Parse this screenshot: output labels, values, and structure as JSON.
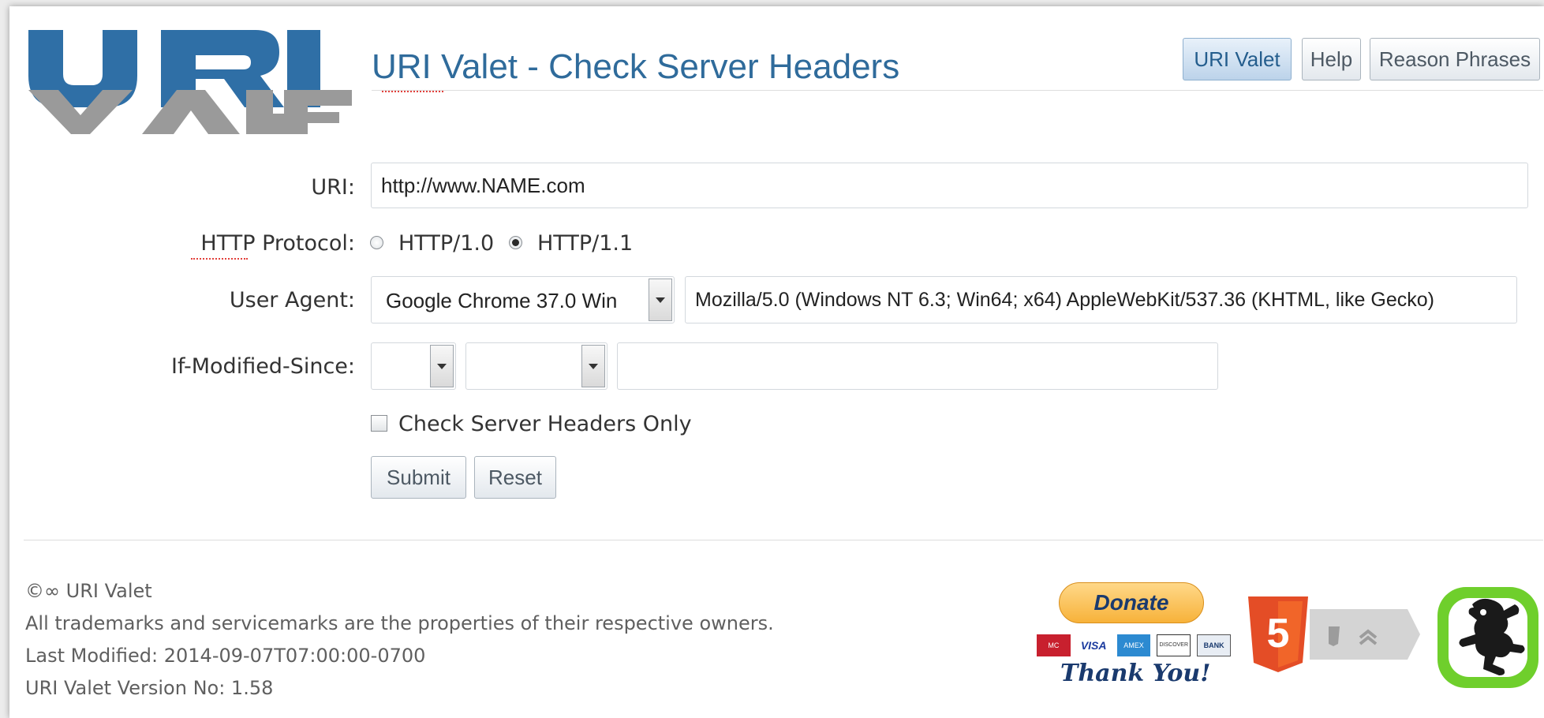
{
  "header": {
    "title": "URI Valet - Check Server Headers",
    "logo_text": "URI VALET",
    "nav": [
      {
        "label": "URI Valet",
        "active": true
      },
      {
        "label": "Help",
        "active": false
      },
      {
        "label": "Reason Phrases",
        "active": false
      }
    ]
  },
  "form": {
    "uri_label": "URI:",
    "uri_value": "http://www.NAME.com",
    "protocol_label": "HTTP Protocol:",
    "protocol_options": [
      "HTTP/1.0",
      "HTTP/1.1"
    ],
    "protocol_selected": "HTTP/1.1",
    "user_agent_label": "User Agent:",
    "user_agent_selected": "Google Chrome 37.0 Win",
    "user_agent_string": "Mozilla/5.0 (Windows NT 6.3; Win64; x64) AppleWebKit/537.36 (KHTML, like Gecko)",
    "if_modified_label": "If-Modified-Since:",
    "if_modified_day": "",
    "if_modified_month": "",
    "if_modified_time": "",
    "headers_only_label": "Check Server Headers Only",
    "headers_only_checked": false,
    "submit_label": "Submit",
    "reset_label": "Reset"
  },
  "footer": {
    "copyright": "©∞ URI Valet",
    "trademarks": "All trademarks and servicemarks are the properties of their respective owners.",
    "last_modified": "Last Modified: 2014-09-07T07:00:00-0700",
    "version": "URI Valet Version No: 1.58",
    "donate_label": "Donate",
    "thank_you": "Thank You!",
    "cards": [
      "MC",
      "VISA",
      "AMEX",
      "DISCOVER",
      "BANK"
    ],
    "html5_label": "5"
  },
  "colors": {
    "title": "#2f6b9b",
    "logo_blue": "#2f6fa6",
    "logo_gray": "#9a9a9a",
    "donate": "#f7b23a",
    "html5": "#e44d26",
    "frog_green": "#6fcf2c"
  }
}
